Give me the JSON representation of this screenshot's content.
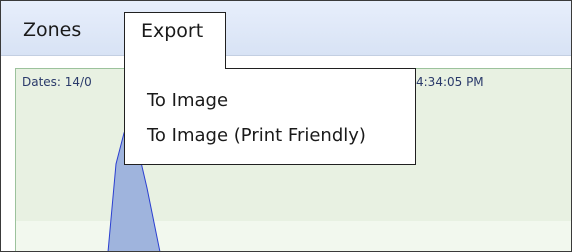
{
  "menubar": {
    "items": [
      {
        "label": "Zones"
      },
      {
        "label": "Export"
      }
    ]
  },
  "export_menu": {
    "items": [
      {
        "label": "To Image"
      },
      {
        "label": "To Image (Print Friendly)"
      }
    ]
  },
  "content": {
    "dates_label": "Dates: 14/0",
    "time_label": "4:34:05 PM"
  },
  "colors": {
    "menubar_bg": "#dce6f7",
    "content_bg": "#e8f1e2",
    "chart_fill": "#9fb4dd",
    "chart_stroke": "#2b3fd1"
  }
}
